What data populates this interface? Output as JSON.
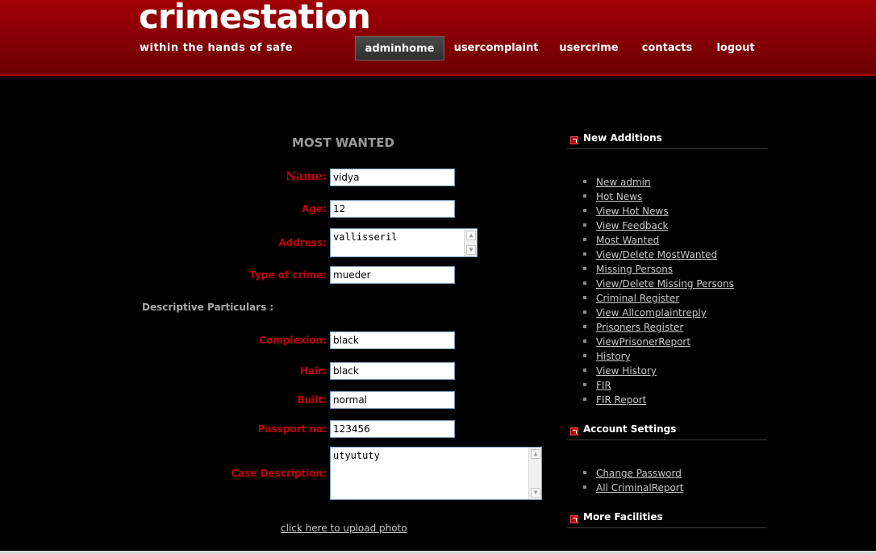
{
  "header": {
    "logo": "crimestation",
    "tagline": "within the hands of safe",
    "nav": [
      {
        "label": "adminhome",
        "active": true
      },
      {
        "label": "usercomplaint"
      },
      {
        "label": "usercrime"
      },
      {
        "label": "contacts"
      },
      {
        "label": "logout"
      }
    ]
  },
  "form": {
    "title": "MOST WANTED",
    "name_label": "Name:",
    "name_value": "vidya",
    "age_label": "Age:",
    "age_value": "12",
    "address_label": "Address:",
    "address_value": "vallisseril",
    "crime_label": "Type of crime:",
    "crime_value": "mueder",
    "descriptive_heading": "Descriptive Particulars :",
    "complexion_label": "Complexion:",
    "complexion_value": "black",
    "hair_label": "Hair:",
    "hair_value": "black",
    "built_label": "Built:",
    "built_value": "normal",
    "passport_label": "Passport no:",
    "passport_value": "123456",
    "case_label": "Case Description:",
    "case_value": "utyututy",
    "upload_link": "click here to upload photo"
  },
  "sidebar": {
    "new_additions": {
      "title": "New Additions",
      "items": [
        "New admin",
        "Hot News",
        "View Hot News",
        "View Feedback",
        "Most Wanted",
        "View/Delete MostWanted",
        "Missing Persons",
        "View/Delete Missing Persons",
        "Criminal Register",
        "View Allcomplaintreply",
        "Prisoners Register",
        "ViewPrisonerReport",
        "History",
        "View History",
        "FIR",
        "FIR Report"
      ]
    },
    "account_settings": {
      "title": "Account Settings",
      "items": [
        "Change Password",
        "All CriminalReport"
      ]
    },
    "more_facilities": {
      "title": "More Facilities"
    }
  }
}
